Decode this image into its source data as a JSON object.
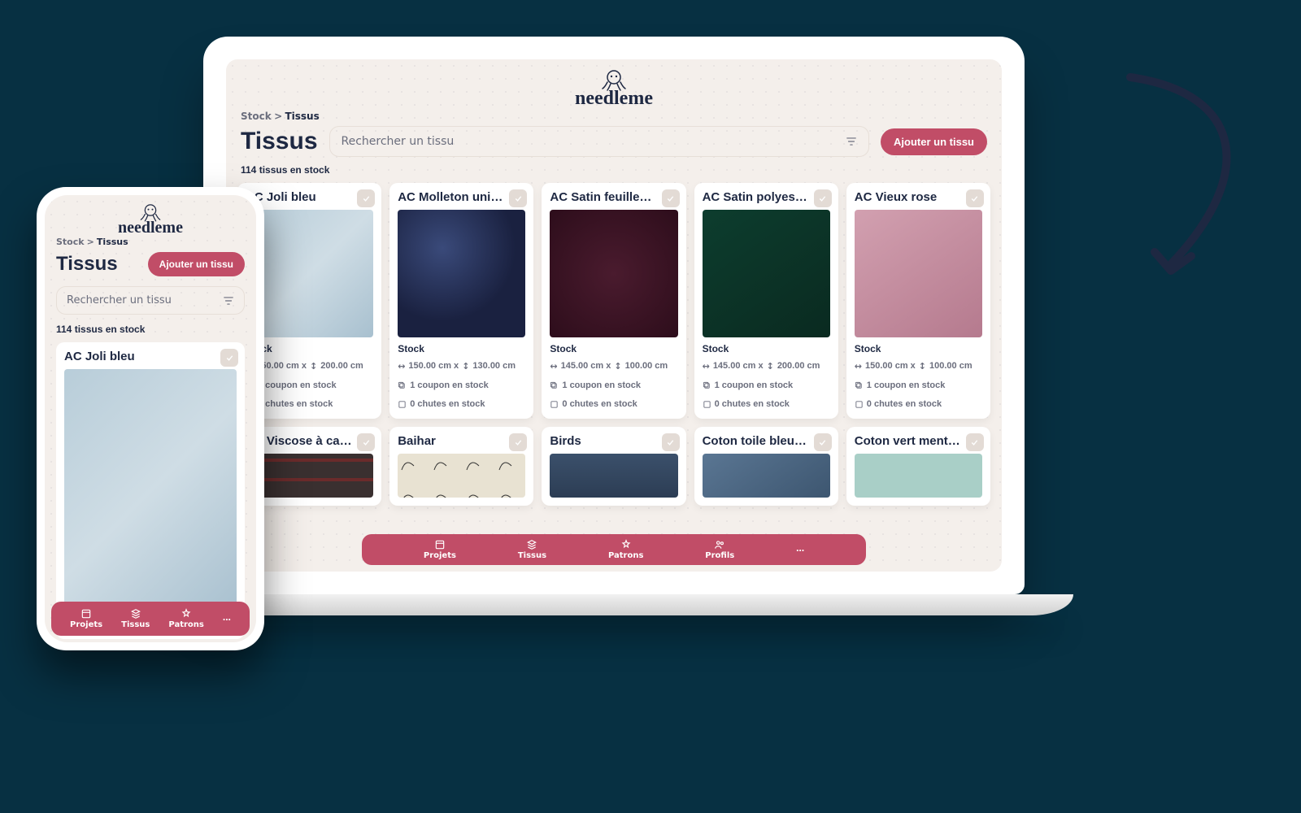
{
  "brand": "needleme",
  "breadcrumb": {
    "root": "Stock",
    "sep": ">",
    "here": "Tissus"
  },
  "page_title": "Tissus",
  "search": {
    "placeholder": "Rechercher un tissu"
  },
  "add_button": "Ajouter un tissu",
  "count": "114 tissus en stock",
  "labels": {
    "stock": "Stock",
    "coupon_1": "1 coupon en stock",
    "chutes_0": "0 chutes en stock"
  },
  "cards_row1": [
    {
      "title": "AC Joli bleu",
      "dims_w": "150.00 cm",
      "dims_h": "200.00 cm",
      "sw": "sw-blue"
    },
    {
      "title": "AC Molleton uni …",
      "dims_w": "150.00 cm",
      "dims_h": "130.00 cm",
      "sw": "sw-navy"
    },
    {
      "title": "AC Satin feuilles …",
      "dims_w": "145.00 cm",
      "dims_h": "100.00 cm",
      "sw": "sw-bordeaux"
    },
    {
      "title": "AC Satin polyest…",
      "dims_w": "145.00 cm",
      "dims_h": "200.00 cm",
      "sw": "sw-green"
    },
    {
      "title": "AC Vieux rose",
      "dims_w": "150.00 cm",
      "dims_h": "100.00 cm",
      "sw": "sw-rose"
    }
  ],
  "cards_row2": [
    {
      "title": "AC Viscose à car…",
      "sw": "sw-plaid"
    },
    {
      "title": "Baihar",
      "sw": "sw-pattern"
    },
    {
      "title": "Birds",
      "sw": "sw-birds"
    },
    {
      "title": "Coton toile bleu / …",
      "sw": "sw-denim"
    },
    {
      "title": "Coton vert ment…",
      "sw": "sw-mint"
    }
  ],
  "nav": {
    "projets": "Projets",
    "tissus": "Tissus",
    "patrons": "Patrons",
    "profils": "Profils",
    "more": "…"
  },
  "phone_card": {
    "title": "AC Joli bleu"
  }
}
